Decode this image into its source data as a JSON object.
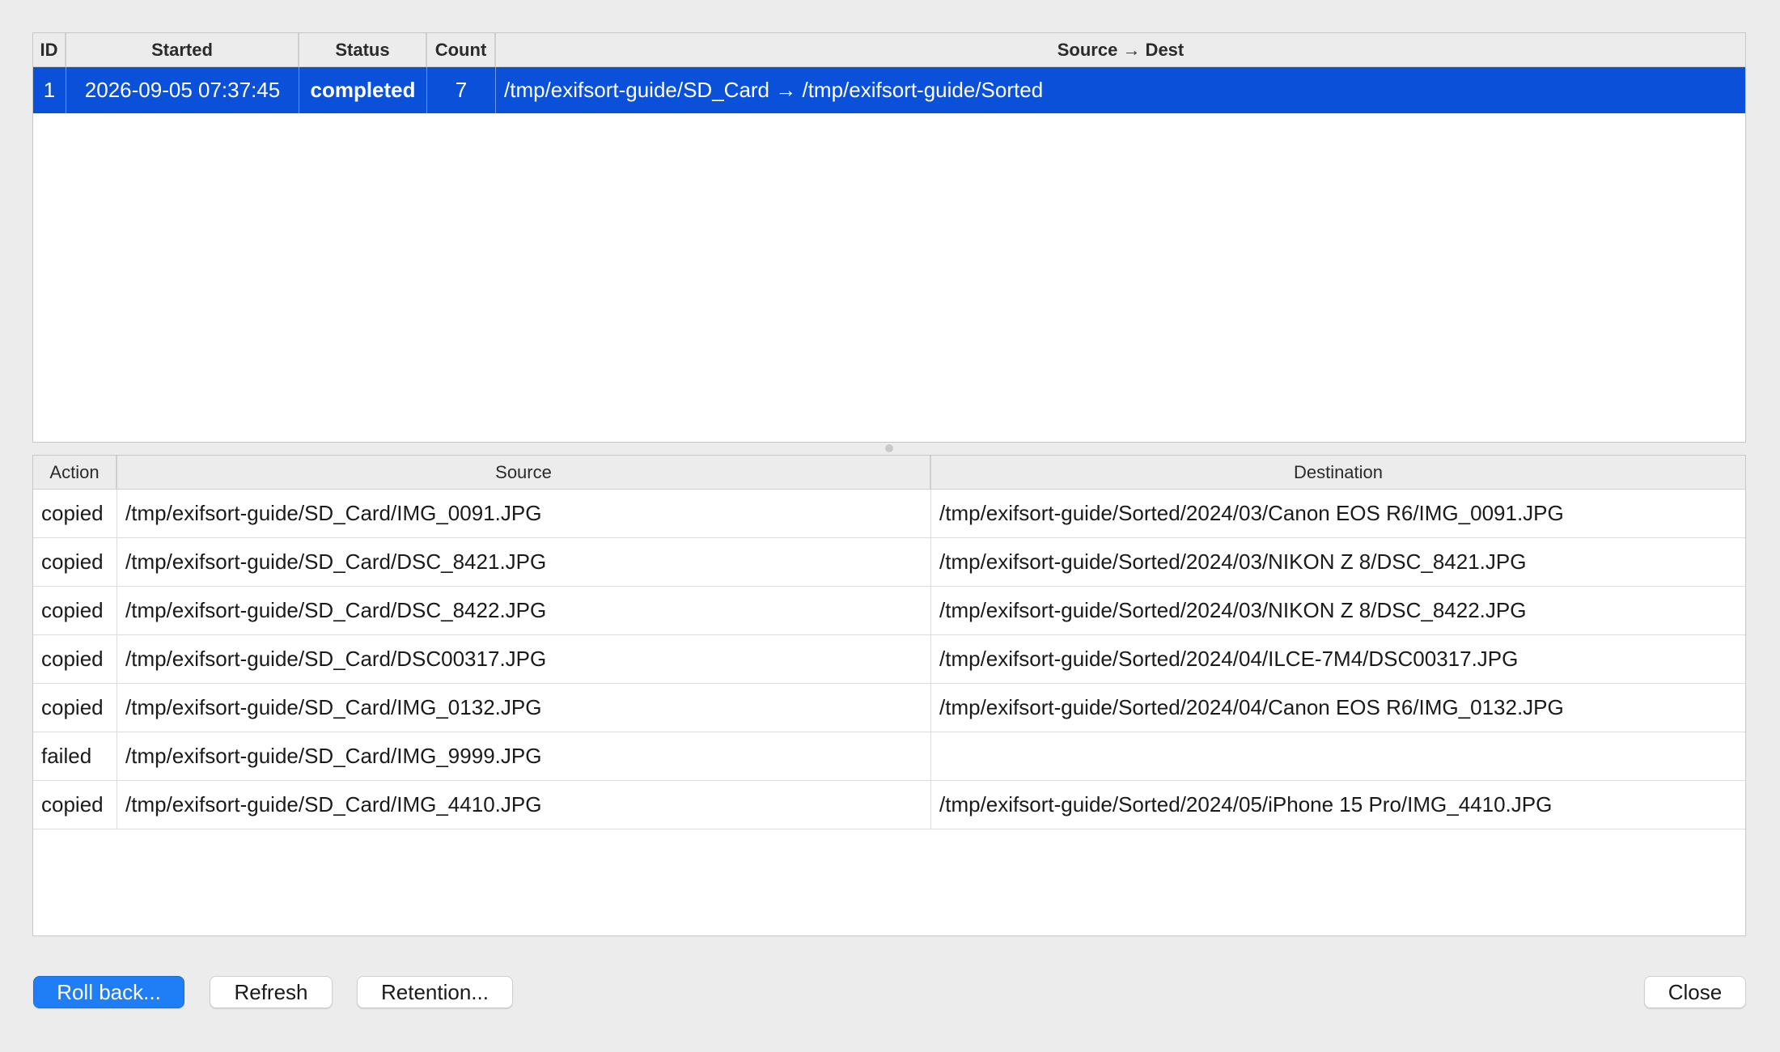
{
  "runs": {
    "columns": [
      "ID",
      "Started",
      "Status",
      "Count",
      "Source → Dest"
    ],
    "rows": [
      {
        "id": "1",
        "started": "2026-09-05 07:37:45",
        "status": "completed",
        "count": "7",
        "route": "/tmp/exifsort-guide/SD_Card → /tmp/exifsort-guide/Sorted",
        "selected": true
      }
    ]
  },
  "actions": {
    "columns": [
      "Action",
      "Source",
      "Destination"
    ],
    "rows": [
      {
        "action": "copied",
        "source": "/tmp/exifsort-guide/SD_Card/IMG_0091.JPG",
        "destination": "/tmp/exifsort-guide/Sorted/2024/03/Canon EOS R6/IMG_0091.JPG"
      },
      {
        "action": "copied",
        "source": "/tmp/exifsort-guide/SD_Card/DSC_8421.JPG",
        "destination": "/tmp/exifsort-guide/Sorted/2024/03/NIKON Z 8/DSC_8421.JPG"
      },
      {
        "action": "copied",
        "source": "/tmp/exifsort-guide/SD_Card/DSC_8422.JPG",
        "destination": "/tmp/exifsort-guide/Sorted/2024/03/NIKON Z 8/DSC_8422.JPG"
      },
      {
        "action": "copied",
        "source": "/tmp/exifsort-guide/SD_Card/DSC00317.JPG",
        "destination": "/tmp/exifsort-guide/Sorted/2024/04/ILCE-7M4/DSC00317.JPG"
      },
      {
        "action": "copied",
        "source": "/tmp/exifsort-guide/SD_Card/IMG_0132.JPG",
        "destination": "/tmp/exifsort-guide/Sorted/2024/04/Canon EOS R6/IMG_0132.JPG"
      },
      {
        "action": "failed",
        "source": "/tmp/exifsort-guide/SD_Card/IMG_9999.JPG",
        "destination": ""
      },
      {
        "action": "copied",
        "source": "/tmp/exifsort-guide/SD_Card/IMG_4410.JPG",
        "destination": "/tmp/exifsort-guide/Sorted/2024/05/iPhone 15 Pro/IMG_4410.JPG"
      }
    ]
  },
  "buttons": {
    "rollback": "Roll back...",
    "refresh": "Refresh",
    "retention": "Retention...",
    "close": "Close"
  },
  "colors": {
    "selection": "#0b50d9",
    "primary_button": "#1f7df6",
    "window_background": "#ececec"
  }
}
